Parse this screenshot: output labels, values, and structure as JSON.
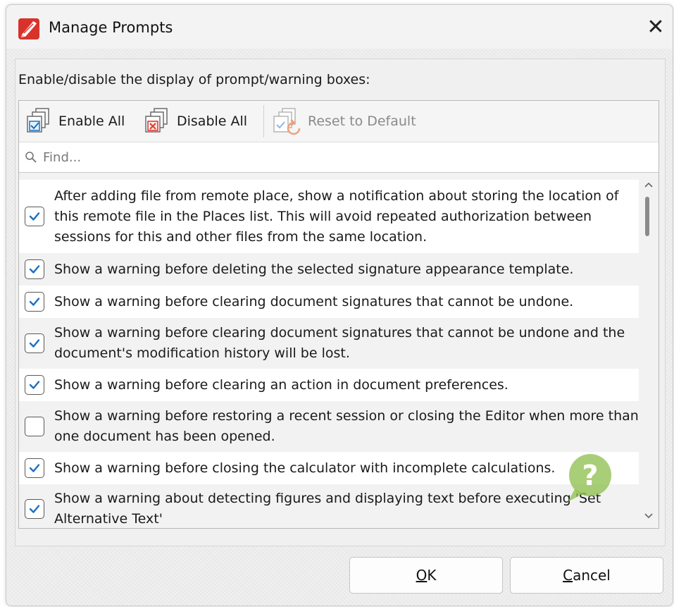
{
  "window": {
    "title": "Manage Prompts",
    "close_glyph": "✕",
    "app_icon": "pdf-editor-app-icon"
  },
  "instruction": "Enable/disable the display of prompt/warning boxes:",
  "toolbar": {
    "enable_all": "Enable All",
    "disable_all": "Disable All",
    "reset_to_default": "Reset to Default"
  },
  "search": {
    "placeholder": "Find..."
  },
  "items": [
    {
      "text": "After adding file from remote place, show a notification about storing the location of this remote file in the Places list.  This will avoid repeated authorization between sessions for this and other files from the same location.",
      "checked": true
    },
    {
      "text": "Show a warning before deleting the selected signature appearance template.",
      "checked": true
    },
    {
      "text": "Show a warning before clearing document signatures that cannot be undone.",
      "checked": true
    },
    {
      "text": "Show a warning before clearing document signatures that cannot be undone and the document's modification history will be lost.",
      "checked": true
    },
    {
      "text": "Show a warning before clearing an action in document preferences.",
      "checked": true
    },
    {
      "text": "Show a warning before restoring a recent session or closing the Editor when more than one document has been opened.",
      "checked": false
    },
    {
      "text": "Show a warning before closing the calculator with incomplete calculations.",
      "checked": true
    },
    {
      "text": "Show a warning about detecting figures and displaying text before executing 'Set Alternative Text'",
      "checked": true
    }
  ],
  "buttons": {
    "ok": "OK",
    "cancel": "Cancel"
  },
  "colors": {
    "accent": "#1a6fc0",
    "app_icon_red": "#d8322b",
    "help_badge_green": "#8bbd4a"
  }
}
